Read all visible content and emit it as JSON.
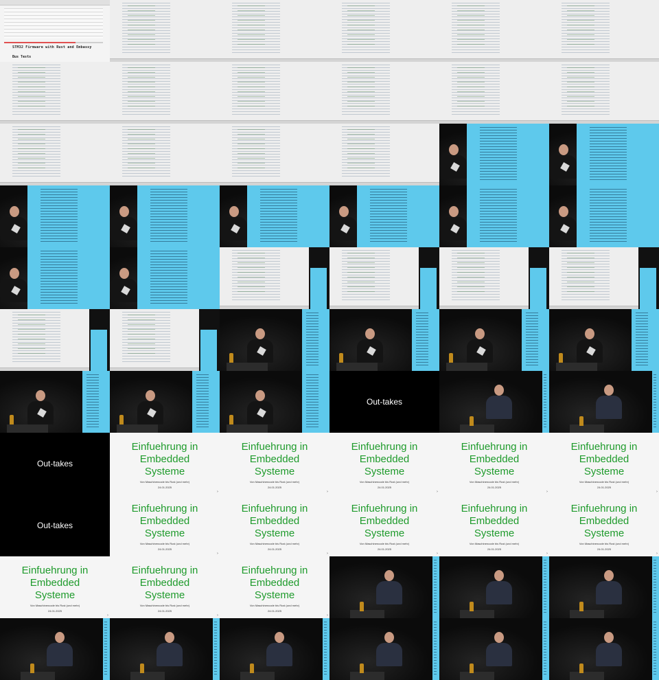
{
  "sheet": {
    "columns": 6,
    "rows": 11
  },
  "webpage": {
    "heading": "STM32 Firmware with Rust and Embassy",
    "subheading": "Bus Tests",
    "progress": 0.72
  },
  "slide": {
    "title_line1": "Einfuehrung in",
    "title_line2": "Embedded",
    "title_line3": "Systeme",
    "subtitle": "Von Maschinencode bis Rust (und mehr)",
    "date": "24.01.2025",
    "arrow": "›"
  },
  "card": {
    "label": "Out-takes"
  },
  "frames": [
    "web",
    "code",
    "code",
    "code",
    "code",
    "code",
    "code",
    "code",
    "code",
    "code",
    "code",
    "code",
    "code",
    "code",
    "code",
    "code",
    "stage-screen",
    "stage-screen",
    "stage-screen",
    "stage-screen",
    "stage-screen",
    "stage-screen",
    "stage-screen",
    "stage-screen",
    "stage-screen",
    "stage-screen",
    "code-dark",
    "code-dark",
    "code-dark",
    "code-dark",
    "code-dark",
    "code-dark",
    "stage-speaker",
    "stage-speaker",
    "stage-speaker",
    "stage-speaker",
    "stage-speaker",
    "stage-speaker",
    "stage-speaker",
    "card",
    "stage-talk",
    "stage-talk",
    "card",
    "slide",
    "slide",
    "slide",
    "slide",
    "slide",
    "card",
    "slide",
    "slide",
    "slide",
    "slide",
    "slide",
    "slide",
    "slide",
    "slide",
    "stage-talk",
    "stage-talk",
    "stage-talk",
    "stage-talk",
    "stage-talk",
    "stage-talk",
    "stage-talk",
    "stage-talk",
    "stage-talk"
  ]
}
